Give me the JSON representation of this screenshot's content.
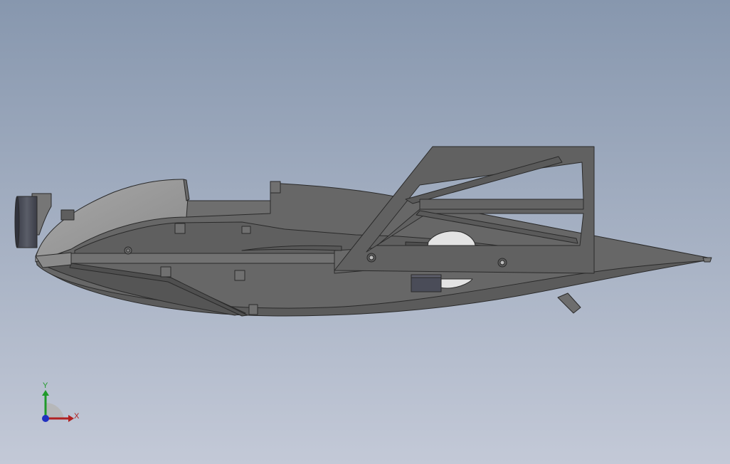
{
  "viewport": {
    "background_top": "#8797ae",
    "background_bottom": "#c3c9d7",
    "model_colors": {
      "body_dark": "#5d5d5d",
      "body_mid": "#696969",
      "body_light": "#7c7c7c",
      "canopy": "#9c9c9c",
      "frame": "#616161",
      "outline": "#2a2a2a",
      "block": "#4a4c58"
    }
  },
  "triad": {
    "x_label": "X",
    "y_label": "Y",
    "x_color": "#b02020",
    "y_color": "#1f9a2a",
    "z_color": "#2030c0"
  }
}
